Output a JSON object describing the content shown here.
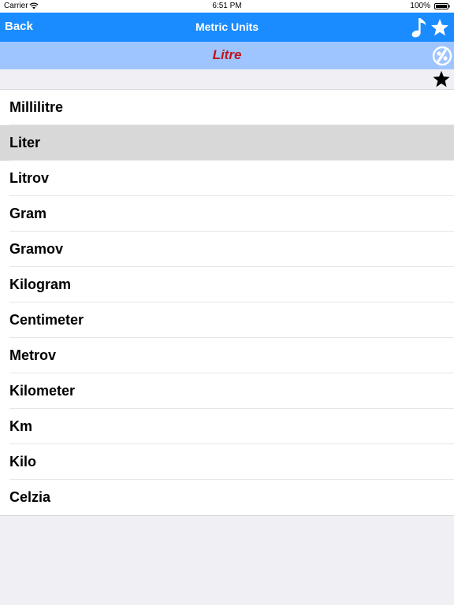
{
  "status_bar": {
    "carrier": "Carrier",
    "time": "6:51 PM",
    "battery": "100%"
  },
  "nav": {
    "back_label": "Back",
    "title": "Metric Units",
    "icons": [
      "music-note-icon",
      "star-icon"
    ],
    "color": "#1a8cff"
  },
  "sub_header": {
    "title": "Litre",
    "title_color": "#c0161c",
    "background": "#9ec5ff",
    "icon": "share-icon"
  },
  "favorite": {
    "icon": "star-icon"
  },
  "list": {
    "selected_index": 1,
    "items": [
      "Millilitre",
      "Liter",
      "Litrov",
      "Gram",
      "Gramov",
      "Kilogram",
      "Centimeter",
      "Metrov",
      "Kilometer",
      "Km",
      "Kilo",
      "Celzia"
    ]
  }
}
